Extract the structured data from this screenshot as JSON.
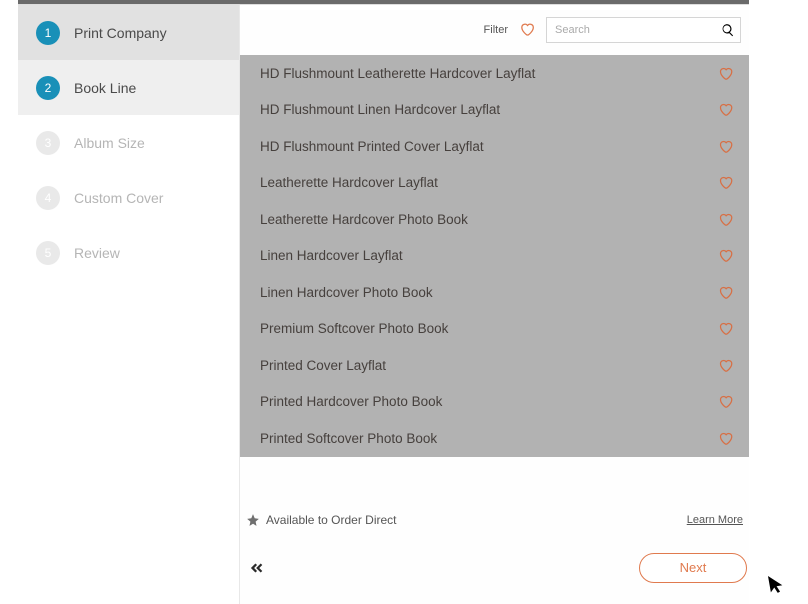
{
  "sidebar": {
    "steps": [
      {
        "num": "1",
        "label": "Print Company"
      },
      {
        "num": "2",
        "label": "Book Line"
      },
      {
        "num": "3",
        "label": "Album Size"
      },
      {
        "num": "4",
        "label": "Custom Cover"
      },
      {
        "num": "5",
        "label": "Review"
      }
    ]
  },
  "filter": {
    "label": "Filter"
  },
  "search": {
    "placeholder": "Search"
  },
  "bookLines": [
    "HD Flushmount Leatherette Hardcover Layflat",
    "HD Flushmount Linen Hardcover Layflat",
    "HD Flushmount Printed Cover Layflat",
    "Leatherette Hardcover Layflat",
    "Leatherette Hardcover Photo Book",
    "Linen Hardcover Layflat",
    "Linen Hardcover Photo Book",
    "Premium Softcover Photo Book",
    "Printed Cover Layflat",
    "Printed Hardcover Photo Book",
    "Printed Softcover Photo Book"
  ],
  "footer": {
    "orderDirect": "Available to Order Direct",
    "learnMore": "Learn More",
    "next": "Next"
  },
  "colors": {
    "accent": "#e07a4e",
    "stepActive": "#1990b8"
  }
}
